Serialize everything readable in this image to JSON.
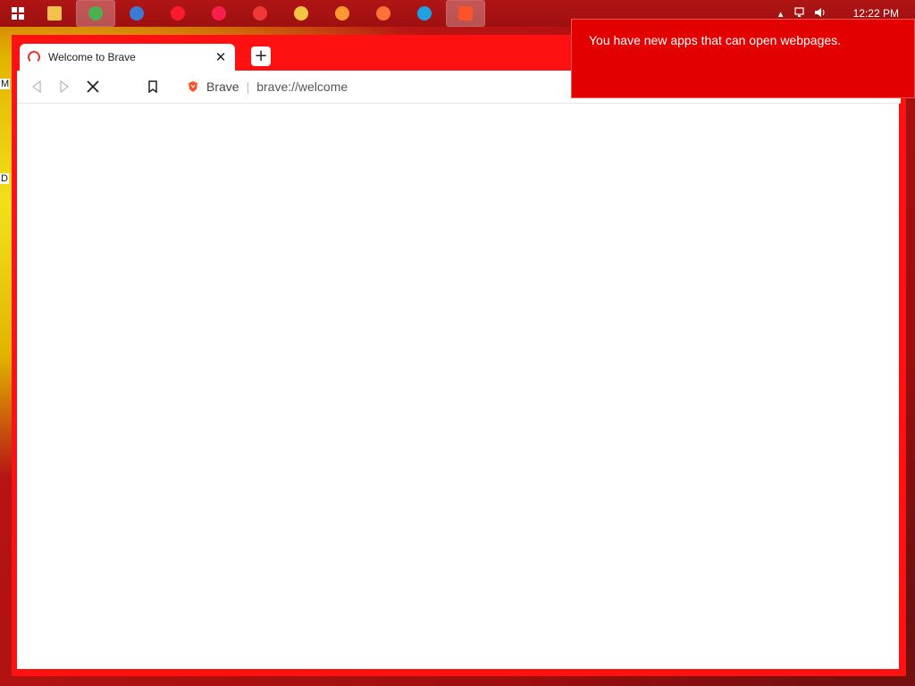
{
  "taskbar": {
    "apps": [
      {
        "name": "file-explorer-icon",
        "color": "#f2c14e"
      },
      {
        "name": "chrome-icon",
        "color": "#4caf50"
      },
      {
        "name": "globe-browser-icon",
        "color": "#3a7bd5"
      },
      {
        "name": "opera-icon",
        "color": "#ff1b2d"
      },
      {
        "name": "opera-gx-icon",
        "color": "#fa1e4e"
      },
      {
        "name": "vivaldi-icon",
        "color": "#ef3939"
      },
      {
        "name": "chromium-icon",
        "color": "#f5c542"
      },
      {
        "name": "yandex-icon",
        "color": "#ff9933"
      },
      {
        "name": "firefox-icon",
        "color": "#ff7139"
      },
      {
        "name": "edge-icon",
        "color": "#1fa0e0"
      },
      {
        "name": "brave-icon",
        "color": "#fb542b"
      }
    ],
    "clock": "12:22 PM"
  },
  "desktop": {
    "fragments": [
      "M",
      "D"
    ]
  },
  "browser": {
    "tab_title": "Welcome to Brave",
    "new_tab_label": "+",
    "close_label": "✕",
    "address": {
      "site": "Brave",
      "url": "brave://welcome"
    }
  },
  "notification": {
    "text": "You have new apps that can open webpages."
  },
  "colors": {
    "window_accent": "#ff1111",
    "toast_bg": "#e30000"
  }
}
